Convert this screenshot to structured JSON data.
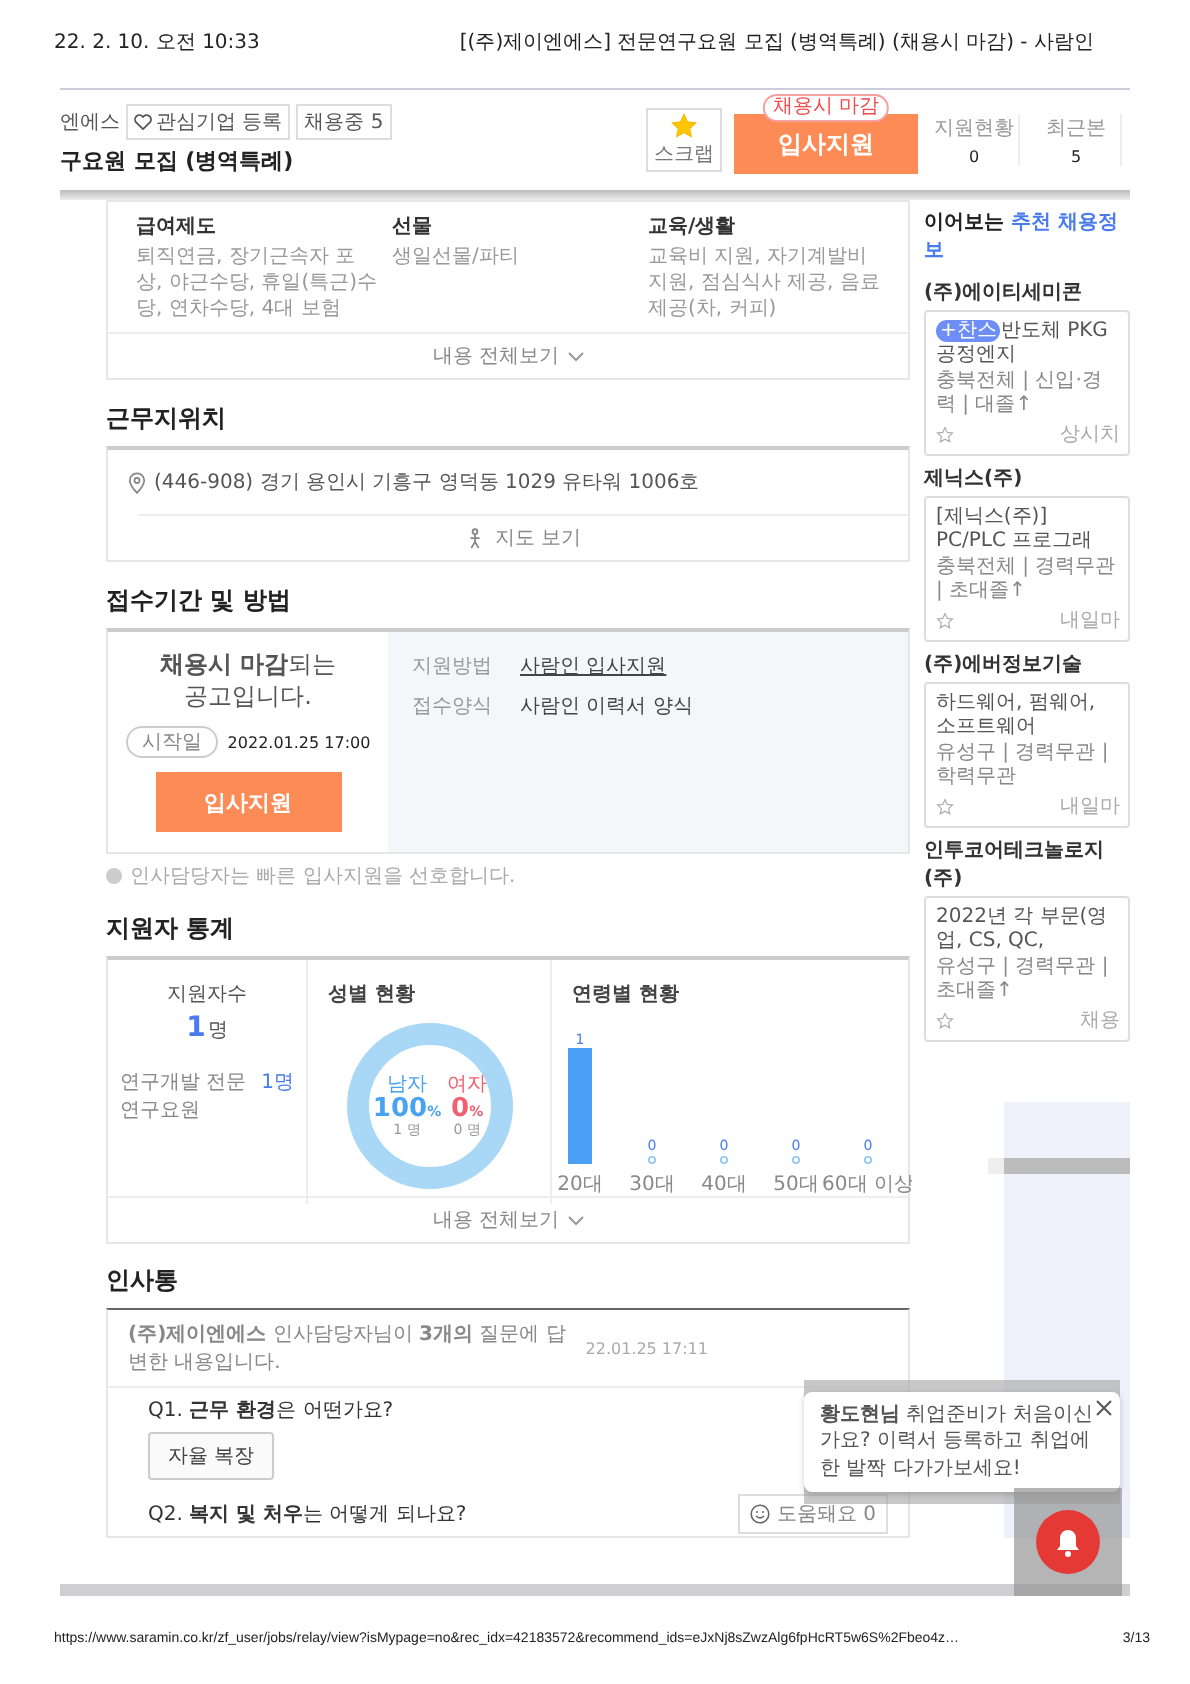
{
  "print_header": {
    "date": "22. 2. 10. 오전 10:33",
    "title": "[(주)제이엔에스] 전문연구요원 모집 (병역특례) (채용시 마감) - 사람인"
  },
  "top_bar": {
    "company": "엔에스",
    "favorite_button": "관심기업 등록",
    "hiring_badge": "채용중 5",
    "job_title": "구요원 모집 (병역특례)",
    "scrap": {
      "label": "스크랩",
      "on": true
    },
    "deadline_tag": "채용시 마감",
    "apply_button": "입사지원",
    "stats": [
      {
        "label": "지원현황",
        "value": "0"
      },
      {
        "label": "최근본",
        "value": "5"
      }
    ]
  },
  "benefits": {
    "items": [
      {
        "heading": "급여제도",
        "text": "퇴직연금, 장기근속자 포상, 야근수당, 휴일(특근)수당, 연차수당, 4대 보험"
      },
      {
        "heading": "선물",
        "text": "생일선물/파티"
      },
      {
        "heading": "교육/생활",
        "text": "교육비 지원, 자기계발비 지원, 점심식사 제공, 음료제공(차, 커피)"
      }
    ],
    "more": "내용 전체보기"
  },
  "location": {
    "heading": "근무지위치",
    "address": "(446-908) 경기 용인시 기흥구 영덕동 1029 유타워 1006호",
    "map_button": "지도 보기"
  },
  "application": {
    "heading": "접수기간 및 방법",
    "notice": "**채용시 마감**되는 공고입니다.",
    "start_label": "시작일",
    "start_date": "2022.01.25 17:00",
    "apply_button": "입사지원",
    "methods": [
      {
        "label": "지원방법",
        "value": "사람인 입사지원",
        "kind": "link"
      },
      {
        "label": "접수양식",
        "value": "사람인 이력서 양식",
        "kind": "text"
      }
    ],
    "note": "인사담당자는 빠른 입사지원을 선호합니다."
  },
  "applicant_stats": {
    "heading": "지원자 통계",
    "total_label": "지원자수",
    "total_count": "1",
    "total_unit": "명",
    "breakdown": [
      {
        "label": "연구개발 전문연구요원",
        "value": "1명"
      }
    ],
    "gender": {
      "title": "성별 현황",
      "groups": [
        {
          "kind": "male",
          "label": "남자",
          "percent": "100",
          "unit": "%",
          "count": "1 명"
        },
        {
          "kind": "female",
          "label": "여자",
          "percent": "0",
          "unit": "%",
          "count": "0 명"
        }
      ]
    },
    "age": {
      "title": "연령별 현황",
      "chart_data": {
        "type": "bar",
        "categories": [
          "20대",
          "30대",
          "40대",
          "50대",
          "60대 이상"
        ],
        "values": [
          1,
          0,
          0,
          0,
          0
        ],
        "data_labels": true
      }
    },
    "more": "내용 전체보기"
  },
  "insatong": {
    "heading": "인사통",
    "summary": "**(주)제이엔에스** 인사담당자님이 **3개의** 질문에 답변한 내용입니다.",
    "date": "22.01.25 17:11",
    "questions": [
      {
        "number": "Q1.",
        "text": "**근무 환경**은 어떤가요?",
        "answers": [
          "자율 복장"
        ]
      },
      {
        "number": "Q2.",
        "text": "**복지 및 처우**는 어떻게 되나요?",
        "reaction": {
          "label": "도움돼요",
          "count": "0"
        }
      }
    ]
  },
  "sidebar": {
    "heading_lead": "이어보는",
    "heading_accent": "추천 채용정보",
    "jobs": [
      {
        "company": "(주)에이티세미콘",
        "badge": "+찬스",
        "title": "반도체 PKG공정엔지",
        "meta": "충북전체 | 신입·경력 | 대졸↑",
        "deadline": "상시치"
      },
      {
        "company": "제닉스(주)",
        "title": "[제닉스(주)] PC/PLC 프로그래",
        "meta": "충북전체 | 경력무관 | 초대졸↑",
        "deadline": "내일마"
      },
      {
        "company": "(주)에버정보기술",
        "title": "하드웨어, 펌웨어, 소프트웨어",
        "meta": "유성구 | 경력무관 | 학력무관",
        "deadline": "내일마"
      },
      {
        "company": "인투코어테크놀로지(주)",
        "title": "2022년 각 부문(영업, CS, QC,",
        "meta": "유성구 | 경력무관 | 초대졸↑",
        "deadline": "채용"
      }
    ]
  },
  "popup": {
    "message": "**황도현님** 취업준비가 처음이신가요? 이력서 등록하고 취업에 한 발짝 다가가보세요!"
  },
  "footer": {
    "url": "https://www.saramin.co.kr/zf_user/jobs/relay/view?isMypage=no&rec_idx=42183572&recommend_ids=eJxNj8sZwzAlg6fpHcRT5w6S%2Fbeo4z…",
    "page": "3/13"
  }
}
